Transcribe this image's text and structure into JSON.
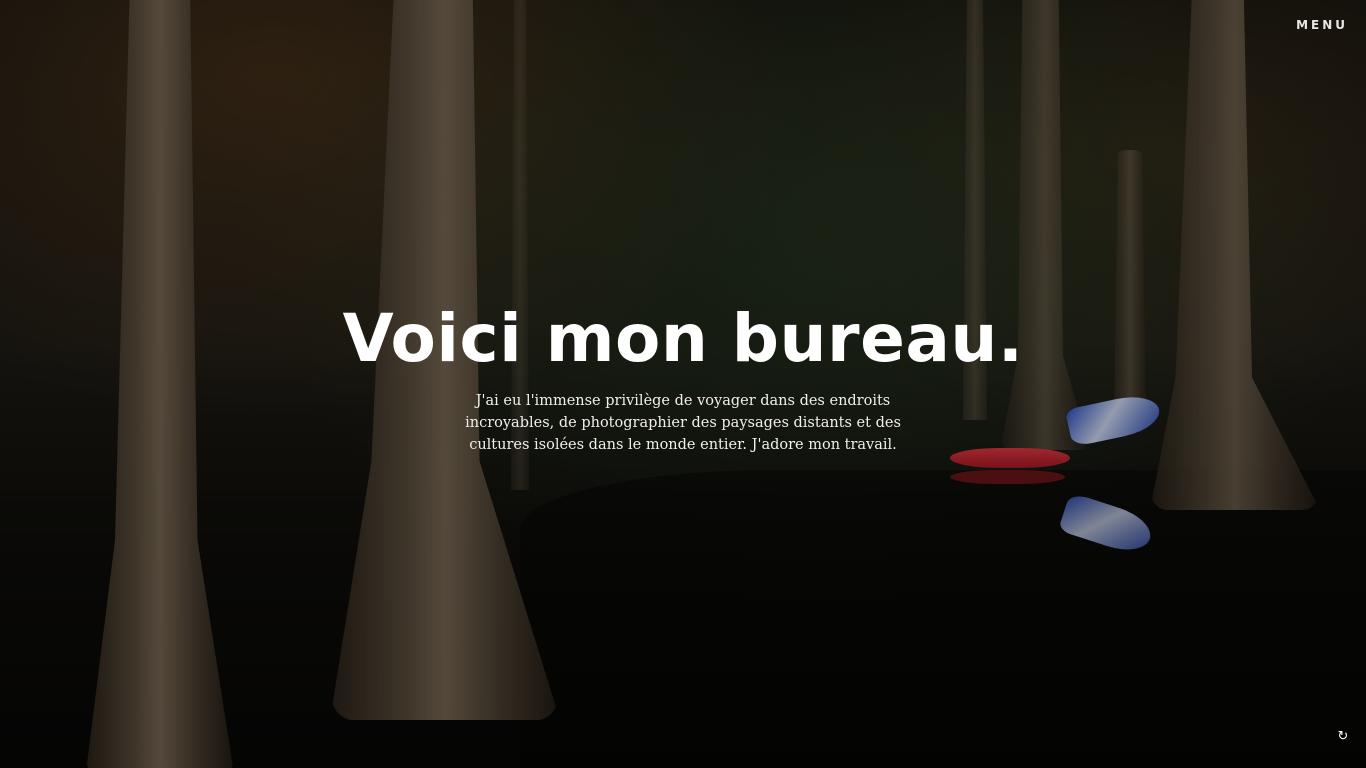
{
  "nav": {
    "menu_label": "MENU"
  },
  "hero": {
    "headline": "Voici mon bureau.",
    "tagline": "J'ai eu l'immense privilège de voyager dans des endroits incroyables, de photographier des paysages distants et des cultures isolées dans le monde entier. J'adore mon travail."
  },
  "icons": {
    "corner": "refresh-icon",
    "corner_glyph": "↻"
  },
  "colors": {
    "text": "#ffffff",
    "kayak": "#e03542",
    "hammock": "#2a4fbf"
  }
}
